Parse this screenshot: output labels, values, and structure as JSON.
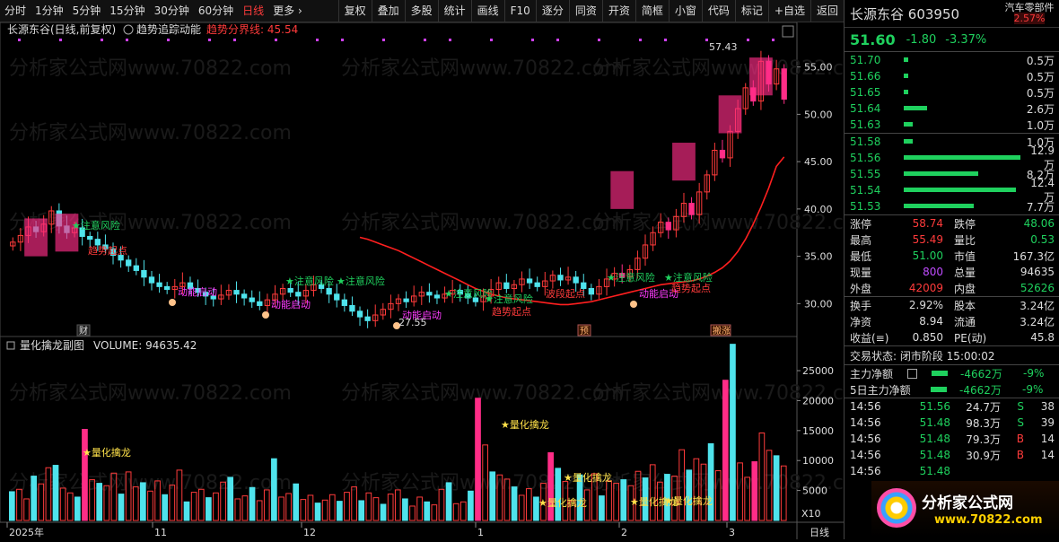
{
  "toolbar": {
    "periods": [
      "分时",
      "1分钟",
      "5分钟",
      "15分钟",
      "30分钟",
      "60分钟",
      "日线",
      "更多 ›"
    ],
    "active_period": "日线",
    "buttons": [
      "复权",
      "叠加",
      "多股",
      "统计",
      "画线",
      "F10",
      "逐分",
      "同资",
      "开资",
      "简框",
      "小窗",
      "代码",
      "标记",
      "+自选",
      "返回"
    ]
  },
  "main_panel": {
    "title": "长源东谷(日线,前复权)",
    "indicator": "趋势追踪动能",
    "boundary_label": "趋势分界线: 45.54",
    "top_price_label": "57.43",
    "low_price_label": "27.55",
    "price_ticks": [
      "55.00",
      "50.00",
      "45.00",
      "40.00",
      "35.00",
      "30.00"
    ],
    "markers": {
      "cai": "财",
      "yu": "预",
      "ban": "搬涨"
    },
    "annotations": {
      "risk": "注意风险",
      "momentum": "动能启动",
      "trend_start": "趋势起点",
      "wave": "波段起点",
      "star_risk": "★注意风险"
    }
  },
  "sub_panel": {
    "title": "量化擒龙副图",
    "volume_label": "VOLUME: 94635.42",
    "volume_ticks": [
      "25000",
      "20000",
      "15000",
      "10000",
      "5000"
    ],
    "x10": "X10",
    "signal": "★量化擒龙"
  },
  "x_axis": {
    "labels": [
      "2025年",
      "11",
      "12",
      "1",
      "2",
      "3"
    ],
    "corner": "日线"
  },
  "chart_data": [
    {
      "type": "candlestick",
      "title": "长源东谷(日线,前复权)",
      "ylim": [
        27,
        58
      ],
      "y_ticks": [
        30,
        35,
        40,
        45,
        50,
        55
      ],
      "annotations": [
        "57.43",
        "27.55",
        "趋势分界线: 45.54"
      ],
      "series": [
        {
          "name": "close_approx",
          "values": [
            36.5,
            37.2,
            38.1,
            37.6,
            38.4,
            39.8,
            38.2,
            37.5,
            38.0,
            37.1,
            36.8,
            36.2,
            35.8,
            35.1,
            34.6,
            34.0,
            33.5,
            32.8,
            32.2,
            31.8,
            31.5,
            31.8,
            32.2,
            31.6,
            31.2,
            30.8,
            30.5,
            30.9,
            31.4,
            31.0,
            30.6,
            30.2,
            29.8,
            30.4,
            31.0,
            31.6,
            31.2,
            30.8,
            31.4,
            32.0,
            31.6,
            31.0,
            30.4,
            29.8,
            29.2,
            28.6,
            28.2,
            28.8,
            29.4,
            30.0,
            30.5,
            30.2,
            30.8,
            31.2,
            30.9,
            30.6,
            31.0,
            31.4,
            31.0,
            30.6,
            30.2,
            30.8,
            31.5,
            32.2,
            31.6,
            32.0,
            32.6,
            32.2,
            31.8,
            32.4,
            33.0,
            32.5,
            32.8,
            32.2,
            31.6,
            31.0,
            31.8,
            32.6,
            33.2,
            32.8,
            33.6,
            34.8,
            36.2,
            37.5,
            38.6,
            37.8,
            39.2,
            40.6,
            39.4,
            41.8,
            43.6,
            46.2,
            45.4,
            48.2,
            50.6,
            52.8,
            51.4,
            55.6,
            53.2,
            54.8,
            51.6
          ]
        },
        {
          "name": "trend_ma_approx",
          "values": [
            37.0,
            36.8,
            36.5,
            36.2,
            35.9,
            35.6,
            35.2,
            34.8,
            34.4,
            34.0,
            33.6,
            33.2,
            32.8,
            32.4,
            32.0,
            31.6,
            31.3,
            31.0,
            30.8,
            30.6,
            30.5,
            30.4,
            30.3,
            30.2,
            30.1,
            30.0,
            29.9,
            29.9,
            30.0,
            30.1,
            30.2,
            30.4,
            30.6,
            30.8,
            31.0,
            31.2,
            31.4,
            31.6,
            31.8,
            32.0,
            32.1,
            32.2,
            32.3,
            32.4,
            32.6,
            32.9,
            33.3,
            33.8,
            34.5,
            35.5,
            36.8,
            38.4,
            40.2,
            42.2,
            44.5,
            45.5
          ]
        }
      ]
    },
    {
      "type": "bar",
      "title": "量化擒龙副图",
      "ylim": [
        0,
        28000
      ],
      "y_ticks": [
        5000,
        10000,
        15000,
        20000,
        25000
      ],
      "annotations": [
        "VOLUME: 94635.42",
        "★量化擒龙"
      ],
      "values": [
        4800,
        5200,
        3600,
        7400,
        6100,
        8800,
        9200,
        5400,
        4600,
        3900,
        15200,
        6800,
        6200,
        5800,
        7900,
        4400,
        8100,
        5600,
        6300,
        4900,
        6600,
        4300,
        5900,
        8400,
        3100,
        4700,
        5200,
        3800,
        4600,
        6400,
        7200,
        3600,
        4100,
        5500,
        3300,
        5100,
        10300,
        3900,
        4500,
        6100,
        3500,
        4200,
        2900,
        3400,
        4300,
        3200,
        4700,
        5600,
        3300,
        4600,
        3800,
        2700,
        4400,
        5100,
        3600,
        2400,
        3900,
        3100,
        2600,
        5200,
        6300,
        2800,
        3100,
        4900,
        20400,
        12600,
        8100,
        7600,
        6900,
        5600,
        4200,
        5300,
        3900,
        6200,
        11300,
        8700,
        6500,
        3300,
        7600,
        5100,
        7800,
        4100,
        6600,
        6200,
        6800,
        5800,
        8200,
        7100,
        9300,
        6400,
        7700,
        7400,
        11800,
        8400,
        10300,
        9400,
        12800,
        8300,
        23400,
        29400,
        9600,
        7200,
        9800,
        14600,
        11700,
        10800,
        9100
      ]
    }
  ],
  "quote_panel": {
    "name": "长源东谷",
    "code": "603950",
    "sector": "汽车零部件",
    "sector_change": "2.57%",
    "price": "51.60",
    "change": "-1.80",
    "change_pct": "-3.37%",
    "asks": [
      {
        "price": "51.70",
        "vol": "0.5万",
        "bar": 0.04
      },
      {
        "price": "51.66",
        "vol": "0.5万",
        "bar": 0.04
      },
      {
        "price": "51.65",
        "vol": "0.5万",
        "bar": 0.04
      },
      {
        "price": "51.64",
        "vol": "2.6万",
        "bar": 0.2
      },
      {
        "price": "51.63",
        "vol": "1.0万",
        "bar": 0.08
      }
    ],
    "bids": [
      {
        "price": "51.58",
        "vol": "1.0万",
        "bar": 0.08
      },
      {
        "price": "51.56",
        "vol": "12.9万",
        "bar": 1.0
      },
      {
        "price": "51.55",
        "vol": "8.2万",
        "bar": 0.64
      },
      {
        "price": "51.54",
        "vol": "12.4万",
        "bar": 0.96
      },
      {
        "price": "51.53",
        "vol": "7.7万",
        "bar": 0.6
      }
    ],
    "stats": [
      {
        "l1": "涨停",
        "v1": "58.74",
        "c1": "red",
        "l2": "跌停",
        "v2": "48.06",
        "c2": "green"
      },
      {
        "l1": "最高",
        "v1": "55.49",
        "c1": "red",
        "l2": "量比",
        "v2": "0.53",
        "c2": "green"
      },
      {
        "l1": "最低",
        "v1": "51.00",
        "c1": "green",
        "l2": "市值",
        "v2": "167.3亿",
        "c2": "white"
      },
      {
        "l1": "现量",
        "v1": "800",
        "c1": "purple",
        "l2": "总量",
        "v2": "94635",
        "c2": "white"
      },
      {
        "l1": "外盘",
        "v1": "42009",
        "c1": "red",
        "l2": "内盘",
        "v2": "52626",
        "c2": "green"
      }
    ],
    "stats2": [
      {
        "l1": "换手",
        "v1": "2.92%",
        "l2": "股本",
        "v2": "3.24亿"
      },
      {
        "l1": "净资",
        "v1": "8.94",
        "l2": "流通",
        "v2": "3.24亿"
      },
      {
        "l1": "收益(≡)",
        "v1": "0.850",
        "l2": "PE(动)",
        "v2": "45.8"
      }
    ],
    "trade_status": "交易状态: 闭市阶段 15:00:02",
    "main_net": {
      "label": "主力净额",
      "value": "-4662万",
      "pct": "-9%"
    },
    "main_net5": {
      "label": "5日主力净额",
      "value": "-4662万",
      "pct": "-9%"
    },
    "ticks": [
      {
        "t": "14:56",
        "p": "51.56",
        "v": "24.7万",
        "s": "S",
        "n": "38"
      },
      {
        "t": "14:56",
        "p": "51.48",
        "v": "98.3万",
        "s": "S",
        "n": "39"
      },
      {
        "t": "14:56",
        "p": "51.48",
        "v": "79.3万",
        "s": "B",
        "n": "14"
      },
      {
        "t": "14:56",
        "p": "51.48",
        "v": "30.9万",
        "s": "B",
        "n": "14"
      },
      {
        "t": "14:56",
        "p": "51.48",
        "v": "",
        "s": "",
        "n": ""
      }
    ],
    "logo": {
      "text": "分析家公式网",
      "url": "www.70822.com"
    }
  },
  "colors": {
    "up": "#ff3b3b",
    "down": "#1fd15e",
    "cyan": "#4fe3ec",
    "pink": "#ff2d87",
    "yellow": "#ffe24a",
    "ma": "#ff1f1f"
  }
}
